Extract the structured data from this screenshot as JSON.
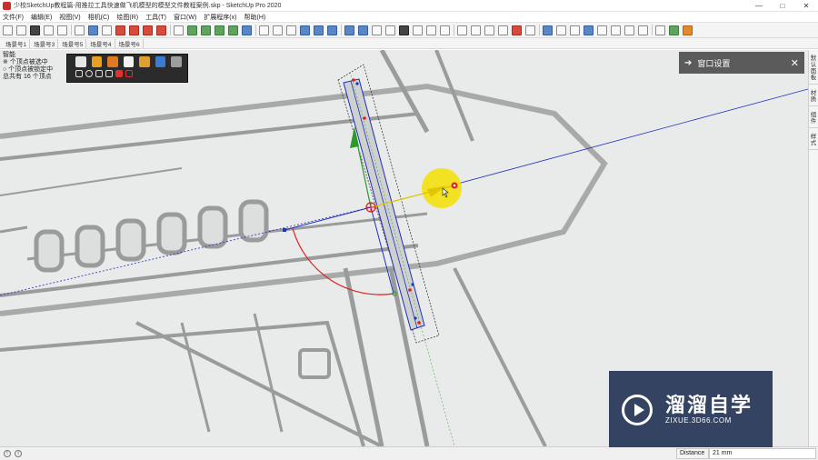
{
  "window": {
    "title": "少校SketchUp教程篇-用推拉工具快速做飞机模型的模型文件教程案例.skp - SketchUp Pro 2020",
    "minimize": "—",
    "maximize": "□",
    "close": "✕"
  },
  "menu": [
    "文件(F)",
    "编辑(E)",
    "视图(V)",
    "相机(C)",
    "绘图(R)",
    "工具(T)",
    "窗口(W)",
    "扩展程序(x)",
    "帮助(H)"
  ],
  "scenes": [
    "场景号1",
    "场景号3",
    "场景号5",
    "场景号4",
    "场景号6"
  ],
  "status_overlay": {
    "line1": "智能",
    "line2": "※ 个顶点被选中",
    "line3": "○ 个顶点被锁定中",
    "line4": "总共有 16 个顶点"
  },
  "window_panel": {
    "title": "窗口设置",
    "arrow_icon": "arrow-right-icon",
    "close": "✕"
  },
  "right_tabs": [
    "默认面板",
    "材质",
    "组件",
    "样式"
  ],
  "statusbar": {
    "measurement_label": "Distance",
    "measurement_value": "21 mm"
  },
  "watermark": {
    "title": "溜溜自学",
    "url": "ZIXUE.3D66.COM"
  },
  "colors": {
    "axis_red": "#e02020",
    "axis_green": "#2a9a2a",
    "axis_blue": "#2030c0",
    "highlight_yellow": "#f4e000",
    "panel_dark": "#5b5b5b",
    "watermark_bg": "#2c3d5c"
  }
}
